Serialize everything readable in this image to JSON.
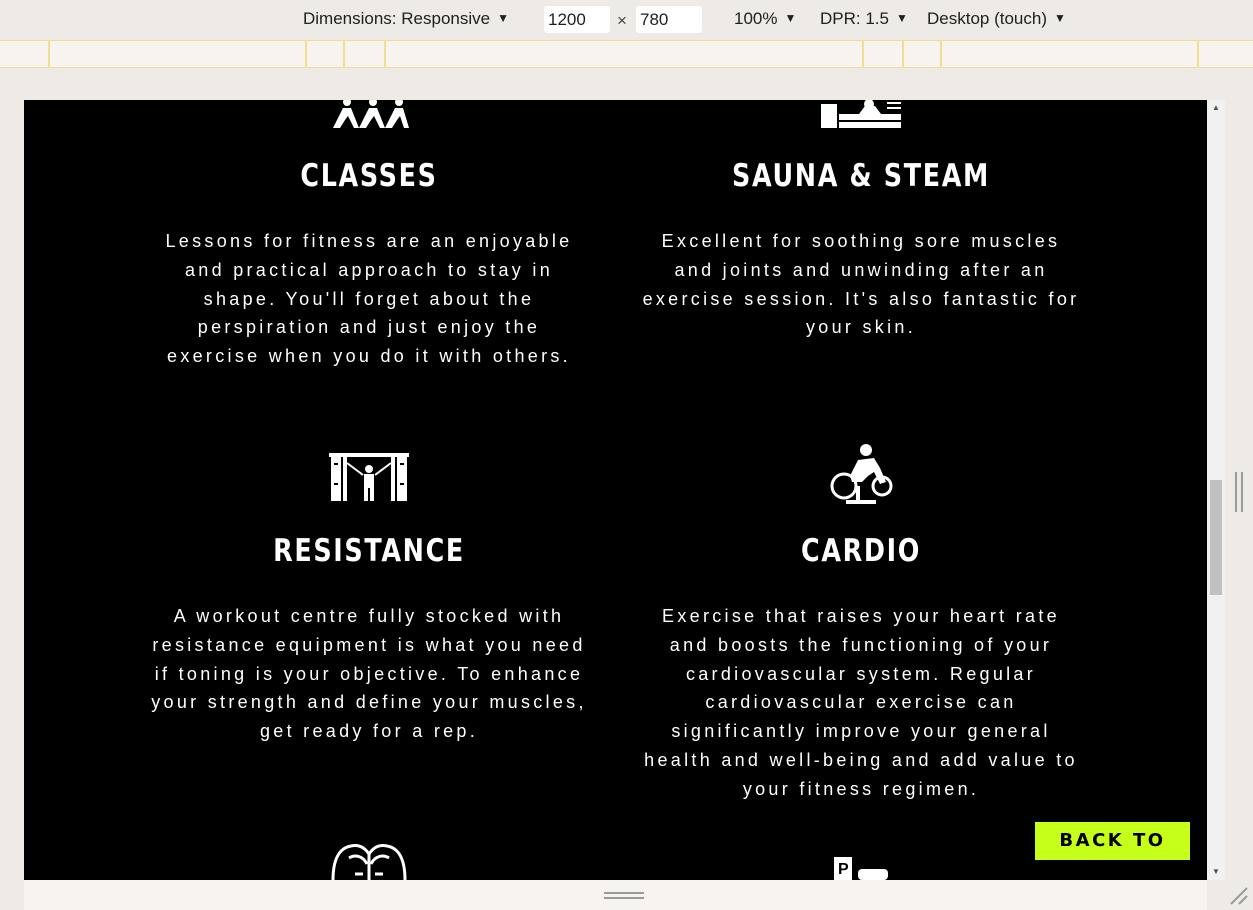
{
  "toolbar": {
    "dimensions_label": "Dimensions: Responsive",
    "width_value": "1200",
    "times": "×",
    "height_value": "780",
    "zoom": "100%",
    "dpr": "DPR: 1.5",
    "device_mode": "Desktop (touch)"
  },
  "features": [
    {
      "title": "CLASSES",
      "icon": "group-fitness-icon",
      "text": "Lessons for fitness are an enjoyable and practical approach to stay in shape. You'll forget about the perspiration and just enjoy the exercise when you do it with others."
    },
    {
      "title": "SAUNA & STEAM",
      "icon": "sauna-icon",
      "text": "Excellent for soothing sore muscles and joints and unwinding after an exercise session. It's also fantastic for your skin."
    },
    {
      "title": "RESISTANCE",
      "icon": "cable-machine-icon",
      "text": "A workout centre fully stocked with resistance equipment is what you need if toning is your objective. To enhance your strength and define your muscles, get ready for a rep."
    },
    {
      "title": "CARDIO",
      "icon": "exercise-bike-icon",
      "text": "Exercise that raises your heart rate and boosts the functioning of your cardiovascular system. Regular cardiovascular exercise can significantly improve your general health and well-being and add value to your fitness regimen."
    }
  ],
  "back_to_top": "BACK TO TOP",
  "colors": {
    "accent": "#c6ff1a",
    "page_background": "#000000",
    "text": "#ffffff"
  }
}
